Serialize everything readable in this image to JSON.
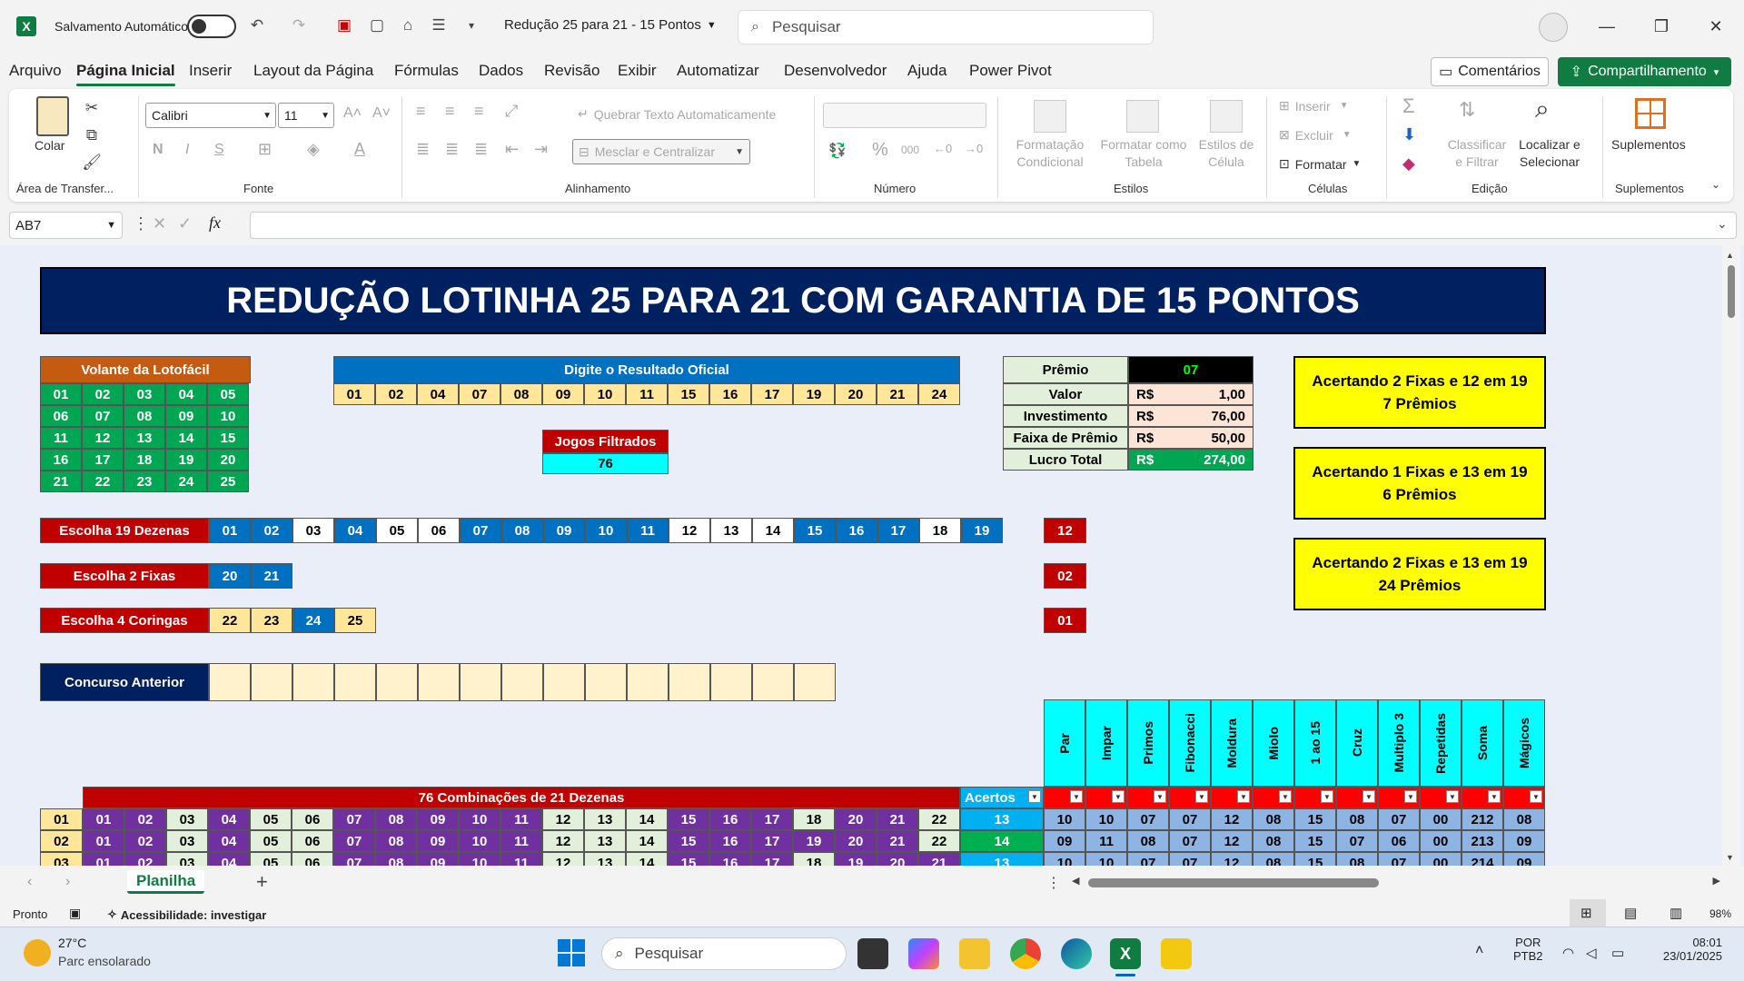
{
  "titlebar": {
    "autosave_label": "Salvamento Automático",
    "doc_title": "Redução 25 para 21 - 15 Pontos",
    "search_placeholder": "Pesquisar"
  },
  "menu": [
    "Arquivo",
    "Página Inicial",
    "Inserir",
    "Layout da Página",
    "Fórmulas",
    "Dados",
    "Revisão",
    "Exibir",
    "Automatizar",
    "Desenvolvedor",
    "Ajuda",
    "Power Pivot"
  ],
  "actions": {
    "comments": "Comentários",
    "share": "Compartilhamento"
  },
  "ribbon": {
    "clipboard": {
      "paste": "Colar",
      "label": "Área de Transfer..."
    },
    "font": {
      "name": "Calibri",
      "size": "11",
      "label": "Fonte"
    },
    "alignment": {
      "wrap": "Quebrar Texto Automaticamente",
      "merge": "Mesclar e Centralizar",
      "label": "Alinhamento"
    },
    "number": {
      "label": "Número"
    },
    "styles": {
      "cond1": "Formatação",
      "cond2": "Condicional",
      "table1": "Formatar como",
      "table2": "Tabela",
      "cell1": "Estilos de",
      "cell2": "Célula",
      "label": "Estilos"
    },
    "cells": {
      "insert": "Inserir",
      "delete": "Excluir",
      "format": "Formatar",
      "label": "Células"
    },
    "editing": {
      "sort1": "Classificar",
      "sort2": "e Filtrar",
      "find1": "Localizar e",
      "find2": "Selecionar",
      "label": "Edição"
    },
    "addins": {
      "btn": "Suplementos",
      "label": "Suplementos"
    }
  },
  "formula": {
    "namebox": "AB7",
    "fx": "fx",
    "value": ""
  },
  "sheet": {
    "title": "REDUÇÃO LOTINHA 25 PARA 21 COM GARANTIA DE 15 PONTOS",
    "volante": {
      "title": "Volante da Lotofácil",
      "rows": [
        [
          "01",
          "02",
          "03",
          "04",
          "05"
        ],
        [
          "06",
          "07",
          "08",
          "09",
          "10"
        ],
        [
          "11",
          "12",
          "13",
          "14",
          "15"
        ],
        [
          "16",
          "17",
          "18",
          "19",
          "20"
        ],
        [
          "21",
          "22",
          "23",
          "24",
          "25"
        ]
      ]
    },
    "resultado": {
      "title": "Digite o Resultado Oficial",
      "values": [
        "01",
        "02",
        "04",
        "07",
        "08",
        "09",
        "10",
        "11",
        "15",
        "16",
        "17",
        "19",
        "20",
        "21",
        "24"
      ]
    },
    "jogos": {
      "title": "Jogos Filtrados",
      "value": "76"
    },
    "premio": {
      "rows": [
        [
          "Prêmio",
          "",
          "07"
        ],
        [
          "Valor",
          "R$",
          "1,00"
        ],
        [
          "Investimento",
          "R$",
          "76,00"
        ],
        [
          "Faixa de Prêmio",
          "R$",
          "50,00"
        ],
        [
          "Lucro Total",
          "R$",
          "274,00"
        ]
      ]
    },
    "boxes": [
      [
        "Acertando 2 Fixas e 12 em 19",
        "7 Prêmios"
      ],
      [
        "Acertando 1 Fixas e 13 em 19",
        "6 Prêmios"
      ],
      [
        "Acertando 2 Fixas e 13 em 19",
        "24 Prêmios"
      ]
    ],
    "escolha19": {
      "label": "Escolha 19 Dezenas",
      "values": [
        "01",
        "02",
        "03",
        "04",
        "05",
        "06",
        "07",
        "08",
        "09",
        "10",
        "11",
        "12",
        "13",
        "14",
        "15",
        "16",
        "17",
        "18",
        "19"
      ],
      "count": "12"
    },
    "fixas": {
      "label": "Escolha 2 Fixas",
      "values": [
        "20",
        "21"
      ],
      "count": "02"
    },
    "coringas": {
      "label": "Escolha 4 Coringas",
      "values": [
        "22",
        "23",
        "24",
        "25"
      ],
      "count": "01"
    },
    "anterior": {
      "label": "Concurso Anterior"
    },
    "combos": {
      "title": "76 Combinações de 21 Dezenas",
      "acertos": "Acertos",
      "stat_headers": [
        "Par",
        "Impar",
        "Primos",
        "Fibonacci",
        "Moldura",
        "Miolo",
        "1 ao 15",
        "Cruz",
        "Multiplo 3",
        "Repetidas",
        "Soma",
        "Mágicos"
      ],
      "rows": [
        {
          "n": "01",
          "d": [
            "01",
            "02",
            "03",
            "04",
            "05",
            "06",
            "07",
            "08",
            "09",
            "10",
            "11",
            "12",
            "13",
            "14",
            "15",
            "16",
            "17",
            "18",
            "20",
            "21",
            "22"
          ],
          "a": "13",
          "s": [
            "10",
            "10",
            "07",
            "07",
            "12",
            "08",
            "15",
            "08",
            "07",
            "00",
            "212",
            "08"
          ]
        },
        {
          "n": "02",
          "d": [
            "01",
            "02",
            "03",
            "04",
            "05",
            "06",
            "07",
            "08",
            "09",
            "10",
            "11",
            "12",
            "13",
            "14",
            "15",
            "16",
            "17",
            "19",
            "20",
            "21",
            "22"
          ],
          "a": "14",
          "s": [
            "09",
            "11",
            "08",
            "07",
            "12",
            "08",
            "15",
            "07",
            "06",
            "00",
            "213",
            "09"
          ]
        },
        {
          "n": "03",
          "d": [
            "01",
            "02",
            "03",
            "04",
            "05",
            "06",
            "07",
            "08",
            "09",
            "10",
            "11",
            "12",
            "13",
            "14",
            "15",
            "16",
            "17",
            "18",
            "19",
            "20",
            "21"
          ],
          "a": "13",
          "s": [
            "10",
            "10",
            "07",
            "07",
            "12",
            "08",
            "15",
            "08",
            "07",
            "00",
            "214",
            "09"
          ]
        }
      ]
    }
  },
  "tabs": {
    "sheet": "Planilha"
  },
  "status": {
    "ready": "Pronto",
    "access": "Acessibilidade: investigar",
    "zoom": "98%"
  },
  "taskbar": {
    "temp": "27°C",
    "weather": "Parc ensolarado",
    "search": "Pesquisar",
    "lang1": "POR",
    "lang2": "PTB2",
    "time": "08:01",
    "date": "23/01/2025"
  }
}
